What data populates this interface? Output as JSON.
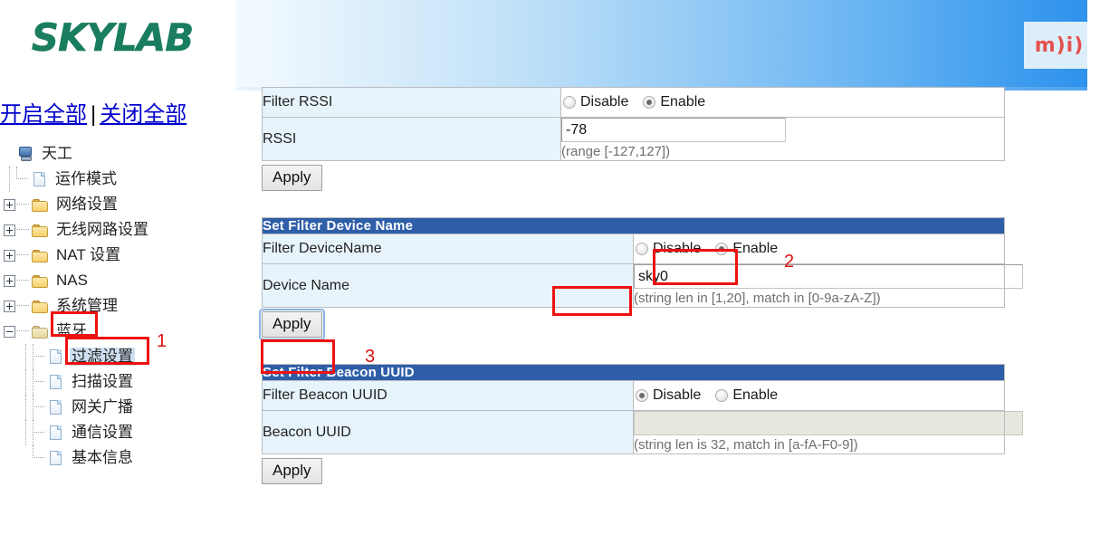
{
  "brand": {
    "logo_text": "SKYLAB",
    "logo_color": "#1a7d5f"
  },
  "banner": {
    "right_logo_text": "m)i)",
    "right_logo_color": "#e4504d"
  },
  "sidebar": {
    "links": {
      "expand_all": "开启全部",
      "separator": "|",
      "collapse_all": "关闭全部"
    },
    "tree": [
      {
        "label": "天工",
        "icon": "computer-icon",
        "level": 0,
        "expander": "none"
      },
      {
        "label": "运作模式",
        "icon": "page-icon",
        "level": 1,
        "expander": "none"
      },
      {
        "label": "网络设置",
        "icon": "folder-icon",
        "level": 1,
        "expander": "plus"
      },
      {
        "label": "无线网路设置",
        "icon": "folder-icon",
        "level": 1,
        "expander": "plus"
      },
      {
        "label": "NAT 设置",
        "icon": "folder-icon",
        "level": 1,
        "expander": "plus"
      },
      {
        "label": "NAS",
        "icon": "folder-icon",
        "level": 1,
        "expander": "plus"
      },
      {
        "label": "系统管理",
        "icon": "folder-icon",
        "level": 1,
        "expander": "plus"
      },
      {
        "label": "蓝牙",
        "icon": "folder-open-icon",
        "level": 1,
        "expander": "minus"
      },
      {
        "label": "过滤设置",
        "icon": "page-icon",
        "level": 2,
        "expander": "none",
        "selected": true
      },
      {
        "label": "扫描设置",
        "icon": "page-icon",
        "level": 2,
        "expander": "none"
      },
      {
        "label": "网关广播",
        "icon": "page-icon",
        "level": 2,
        "expander": "none"
      },
      {
        "label": "通信设置",
        "icon": "page-icon",
        "level": 2,
        "expander": "none"
      },
      {
        "label": "基本信息",
        "icon": "page-icon",
        "level": 2,
        "expander": "none"
      }
    ]
  },
  "annotations": [
    {
      "id": "1",
      "text": "1",
      "target": "sidebar-item-过滤设置"
    },
    {
      "id": "2",
      "text": "2",
      "target": "filter-devicename-enable-radio"
    },
    {
      "id": "3",
      "text": "3",
      "target": "device-name-apply-button"
    }
  ],
  "sections": {
    "rssi": {
      "rows": [
        {
          "label": "Filter RSSI",
          "type": "radio",
          "options": [
            "Disable",
            "Enable"
          ],
          "selected": "Enable"
        },
        {
          "label": "RSSI",
          "type": "text",
          "value": "-78",
          "hint": "(range [-127,127])"
        }
      ],
      "apply_label": "Apply"
    },
    "device_name": {
      "header": "Set Filter Device Name",
      "rows": [
        {
          "label": "Filter DeviceName",
          "type": "radio",
          "options": [
            "Disable",
            "Enable"
          ],
          "selected": "Enable"
        },
        {
          "label": "Device Name",
          "type": "text",
          "value": "sky0",
          "hint": "(string len in [1,20], match in [0-9a-zA-Z])"
        }
      ],
      "apply_label": "Apply"
    },
    "beacon_uuid": {
      "header": "Set Filter Beacon UUID",
      "rows": [
        {
          "label": "Filter Beacon UUID",
          "type": "radio",
          "options": [
            "Disable",
            "Enable"
          ],
          "selected": "Disable"
        },
        {
          "label": "Beacon UUID",
          "type": "text",
          "value": "",
          "hint": "(string len is 32, match in [a-fA-F0-9])",
          "disabled": true
        }
      ],
      "apply_label": "Apply"
    }
  }
}
